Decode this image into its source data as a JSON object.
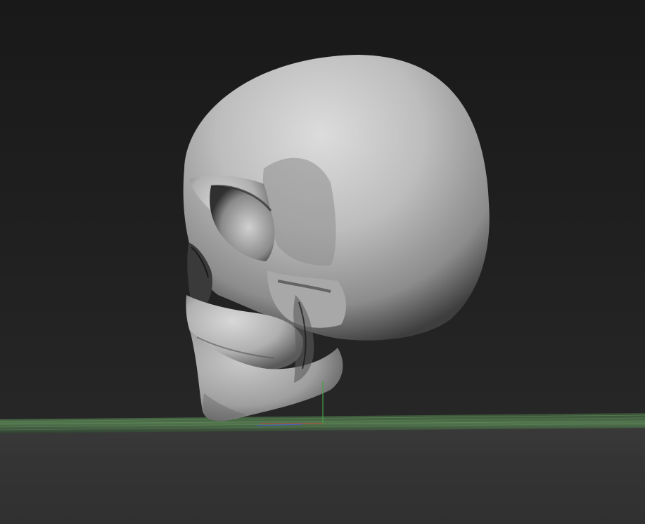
{
  "viewport": {
    "object": "skull-model",
    "background_color": "#1f1f1f",
    "floor_color": "#353535",
    "floor_grid_color": "#4d7a48",
    "axis_colors": {
      "x": "#c04040",
      "y": "#44a044",
      "z": "#4060d0"
    }
  }
}
